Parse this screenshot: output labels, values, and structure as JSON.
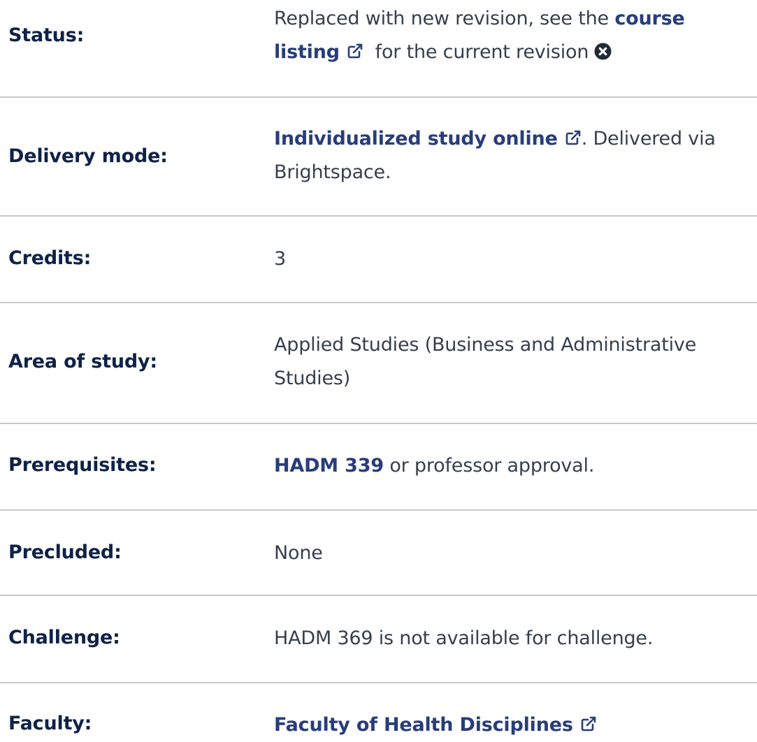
{
  "rows": {
    "status": {
      "label": "Status:",
      "text_before": "Replaced with new revision, see the",
      "link_text": "course listing",
      "text_after": "for the current revision"
    },
    "delivery": {
      "label": "Delivery mode:",
      "link_text": "Individualized study online",
      "text_after": ". Delivered via Brightspace."
    },
    "credits": {
      "label": "Credits:",
      "value": "3"
    },
    "area": {
      "label": "Area of study:",
      "value": "Applied Studies (Business and Administrative Studies)"
    },
    "prereq": {
      "label": "Prerequisites:",
      "link_text": "HADM 339",
      "text_after": "or professor approval."
    },
    "precluded": {
      "label": "Precluded:",
      "value": "None"
    },
    "challenge": {
      "label": "Challenge:",
      "value": "HADM 369 is not available for challenge."
    },
    "faculty": {
      "label": "Faculty:",
      "link_text": "Faculty of Health Disciplines"
    }
  },
  "icons": {
    "external": "external-link-icon",
    "close": "close-circle-icon"
  },
  "colors": {
    "label": "#0f2247",
    "link": "#283d7a",
    "text": "#363f4d",
    "divider": "#c9c9c9"
  }
}
